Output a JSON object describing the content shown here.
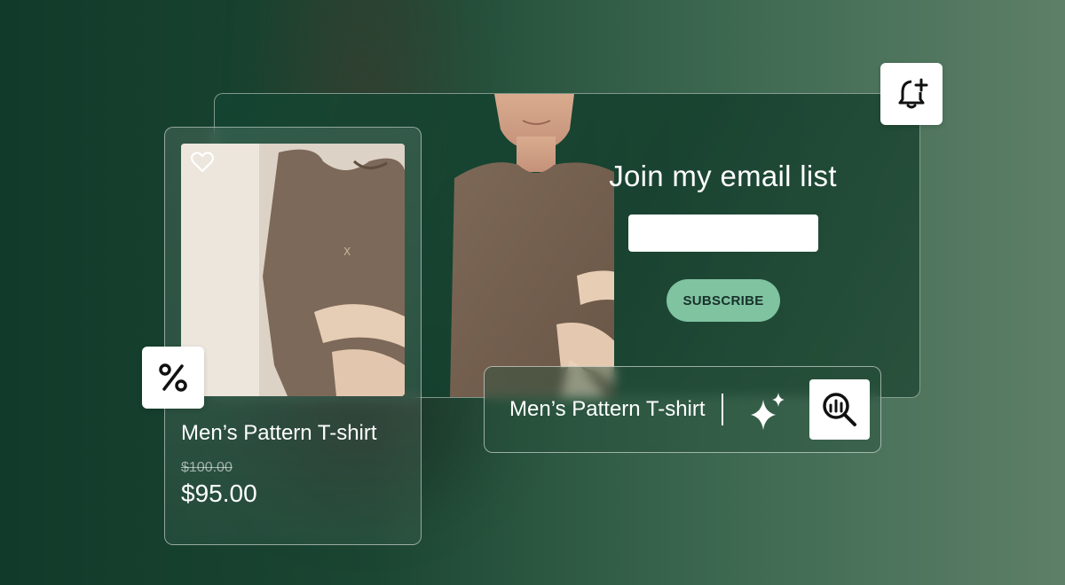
{
  "email_signup": {
    "title": "Join my email list",
    "input_value": "",
    "subscribe_label": "SUBSCRIBE"
  },
  "product": {
    "name": "Men’s Pattern T-shirt",
    "old_price": "$100.00",
    "new_price": "$95.00"
  },
  "search": {
    "query": "Men’s Pattern T-shirt"
  },
  "icons": {
    "notification": "bell-plus-icon",
    "discount": "percent-icon",
    "favorite": "heart-icon",
    "ai": "sparkle-icon",
    "search": "search-analytics-icon"
  },
  "colors": {
    "accent": "#7fc3a1",
    "background_dark": "#123a2a",
    "background_light": "#5e7f68"
  }
}
